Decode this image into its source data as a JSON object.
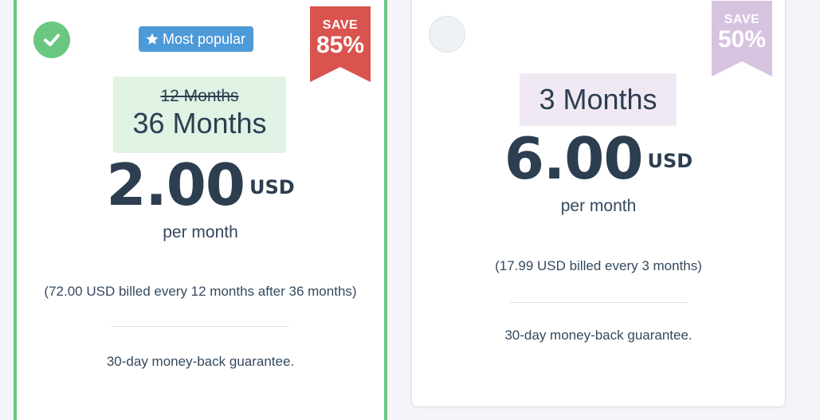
{
  "plans": [
    {
      "selected": true,
      "badge": "Most popular",
      "ribbon": {
        "save": "SAVE",
        "percent": "85%",
        "color": "#d9534f"
      },
      "old_term": "12 Months",
      "term": "36 Months",
      "price": "2.00",
      "currency": "USD",
      "per": "per month",
      "billed": "(72.00 USD billed every 12 months after 36 months)",
      "guarantee": "30-day money-back guarantee.",
      "term_bg": "#e0f3e4"
    },
    {
      "selected": false,
      "ribbon": {
        "save": "SAVE",
        "percent": "50%",
        "color": "#d6c3e0"
      },
      "term": "3 Months",
      "price": "6.00",
      "currency": "USD",
      "per": "per month",
      "billed": "(17.99 USD billed every 3 months)",
      "guarantee": "30-day money-back guarantee.",
      "term_bg": "#f0e9f4"
    }
  ],
  "colors": {
    "selected_border": "#6ac77f",
    "badge_blue": "#4d9ad8",
    "text_dark": "#2c3e50"
  },
  "icons": {
    "selected": "check-circle-icon",
    "unselected": "radio-empty-icon",
    "badge": "star-icon"
  }
}
